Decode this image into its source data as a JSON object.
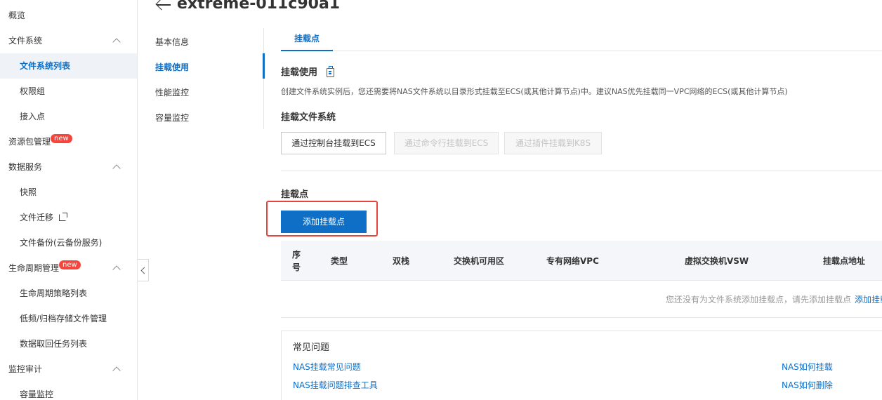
{
  "header": {
    "title": "extreme-011c90a1"
  },
  "sidebar": {
    "items": [
      {
        "label": "概览",
        "level": 0
      },
      {
        "label": "文件系统",
        "level": 0,
        "expandable": true
      },
      {
        "label": "文件系统列表",
        "level": 1,
        "active": true
      },
      {
        "label": "权限组",
        "level": 1
      },
      {
        "label": "接入点",
        "level": 1
      },
      {
        "label": "资源包管理",
        "level": 0,
        "badge": "new"
      },
      {
        "label": "数据服务",
        "level": 0,
        "expandable": true
      },
      {
        "label": "快照",
        "level": 1
      },
      {
        "label": "文件迁移",
        "level": 1,
        "external": true
      },
      {
        "label": "文件备份(云备份服务)",
        "level": 1
      },
      {
        "label": "生命周期管理",
        "level": 0,
        "badge": "new",
        "expandable": true
      },
      {
        "label": "生命周期策略列表",
        "level": 1
      },
      {
        "label": "低频/归档存储文件管理",
        "level": 1
      },
      {
        "label": "数据取回任务列表",
        "level": 1
      },
      {
        "label": "监控审计",
        "level": 0,
        "expandable": true
      },
      {
        "label": "容量监控",
        "level": 1
      }
    ]
  },
  "subnav": {
    "items": [
      {
        "label": "基本信息"
      },
      {
        "label": "挂载使用",
        "active": true
      },
      {
        "label": "性能监控"
      },
      {
        "label": "容量监控"
      }
    ]
  },
  "tabs": [
    {
      "label": "挂载点",
      "active": true
    }
  ],
  "mount_usage": {
    "title": "挂载使用",
    "description": "创建文件系统实例后，您还需要将NAS文件系统以目录形式挂载至ECS(或其他计算节点)中。建议NAS优先挂载同一VPC网络的ECS(或其他计算节点)",
    "mount_fs_title": "挂载文件系统",
    "buttons": {
      "console": "通过控制台挂载到ECS",
      "cli": "通过命令行挂载到ECS",
      "k8s": "通过插件挂载到K8S"
    }
  },
  "mount_points": {
    "title": "挂载点",
    "add_button": "添加挂载点",
    "columns": [
      "序号",
      "类型",
      "双栈",
      "交换机可用区",
      "专有网络VPC",
      "虚拟交换机VSW",
      "挂载点地址"
    ],
    "empty_text": "您还没有为文件系统添加挂载点，请先添加挂载点",
    "empty_link": "添加挂载点"
  },
  "faq": {
    "title": "常见问题",
    "links": [
      "NAS挂载常见问题",
      "NAS挂载问题排查工具",
      "NAS如何挂载",
      "NAS如何删除"
    ]
  },
  "colors": {
    "accent": "#0f6fc6",
    "highlight": "#e8433a",
    "badge": "#f5453c"
  },
  "icons": [
    "chevron-up-icon",
    "external-link-icon",
    "back-arrow-icon",
    "document-icon",
    "chevron-left-icon"
  ]
}
